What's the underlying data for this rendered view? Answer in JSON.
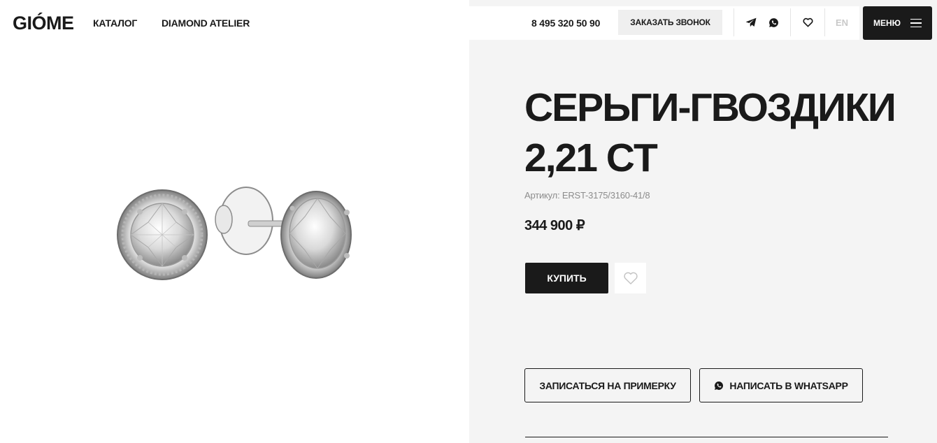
{
  "header": {
    "logo_text": "GIÓME",
    "nav": [
      {
        "label": "КАТАЛОГ"
      },
      {
        "label": "DIAMOND ATELIER"
      }
    ],
    "phone": "8 495 320 50 90",
    "callback_label": "ЗАКАЗАТЬ ЗВОНОК",
    "icons": [
      "telegram-icon",
      "whatsapp-icon",
      "heart-icon"
    ],
    "lang": "EN",
    "menu_label": "МЕНЮ"
  },
  "product": {
    "title": "СЕРЬГИ-ГВОЗДИКИ 2,21 CT",
    "sku": "Артикул: ERST-3175/3160-41/8",
    "price": "344 900 ₽",
    "buy_label": "КУПИТЬ",
    "fitting_label": "ЗАПИСАТЬСЯ НА ПРИМЕРКУ",
    "whatsapp_label": "НАПИСАТЬ В WHATSAPP"
  },
  "colors": {
    "dark": "#1a1a1a",
    "panel_bg": "#f4f4f4",
    "muted": "#8c8c8c",
    "lang_inactive": "#c9c9c9"
  }
}
